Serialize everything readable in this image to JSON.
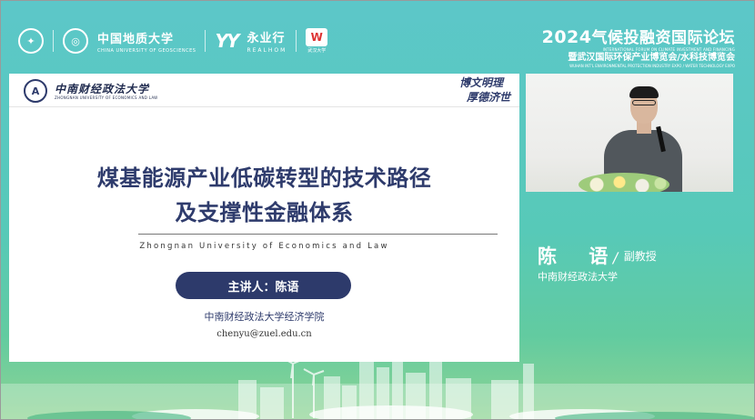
{
  "header": {
    "logo1_icon": "people-emblem-icon",
    "logo2_name": "中国地质大学",
    "logo2_en": "CHINA UNIVERSITY OF GEOSCIENCES",
    "logo3_mark": "YY",
    "logo3_name": "永业行",
    "logo3_en": "REALHOM",
    "logo4_mark": "W",
    "logo4_sub": "武汉大学"
  },
  "forum": {
    "year": "2024",
    "title": "气候投融资国际论坛",
    "en_line1": "INTERNATIONAL FORUM ON CLIMATE INVESTMENT AND FINANCING",
    "subtitle": "暨武汉国际环保产业博览会/水科技博览会",
    "en_line2": "WUHAN INT'L ENVIRONMENTAL PROTECTION INDUSTRY EXPO / WATER TECHNOLOGY EXPO"
  },
  "slide": {
    "university_name": "中南财经政法大学",
    "university_en": "ZHONGNAN UNIVERSITY OF ECONOMICS AND LAW",
    "motto_line1": "博文明理",
    "motto_line2": "厚德济世",
    "title_line1": "煤基能源产业低碳转型的技术路径",
    "title_line2": "及支撑性金融体系",
    "english_name": "Zhongnan University of Economics and Law",
    "presenter_label": "主讲人：陈语",
    "school": "中南财经政法大学经济学院",
    "email": "chenyu@zuel.edu.cn"
  },
  "speaker": {
    "name": "陈 语",
    "separator": "/",
    "title": "副教授",
    "organization": "中南财经政法大学"
  },
  "colors": {
    "background_teal": "#5cc7c9",
    "navy": "#2d3a6b",
    "white": "#ffffff"
  }
}
